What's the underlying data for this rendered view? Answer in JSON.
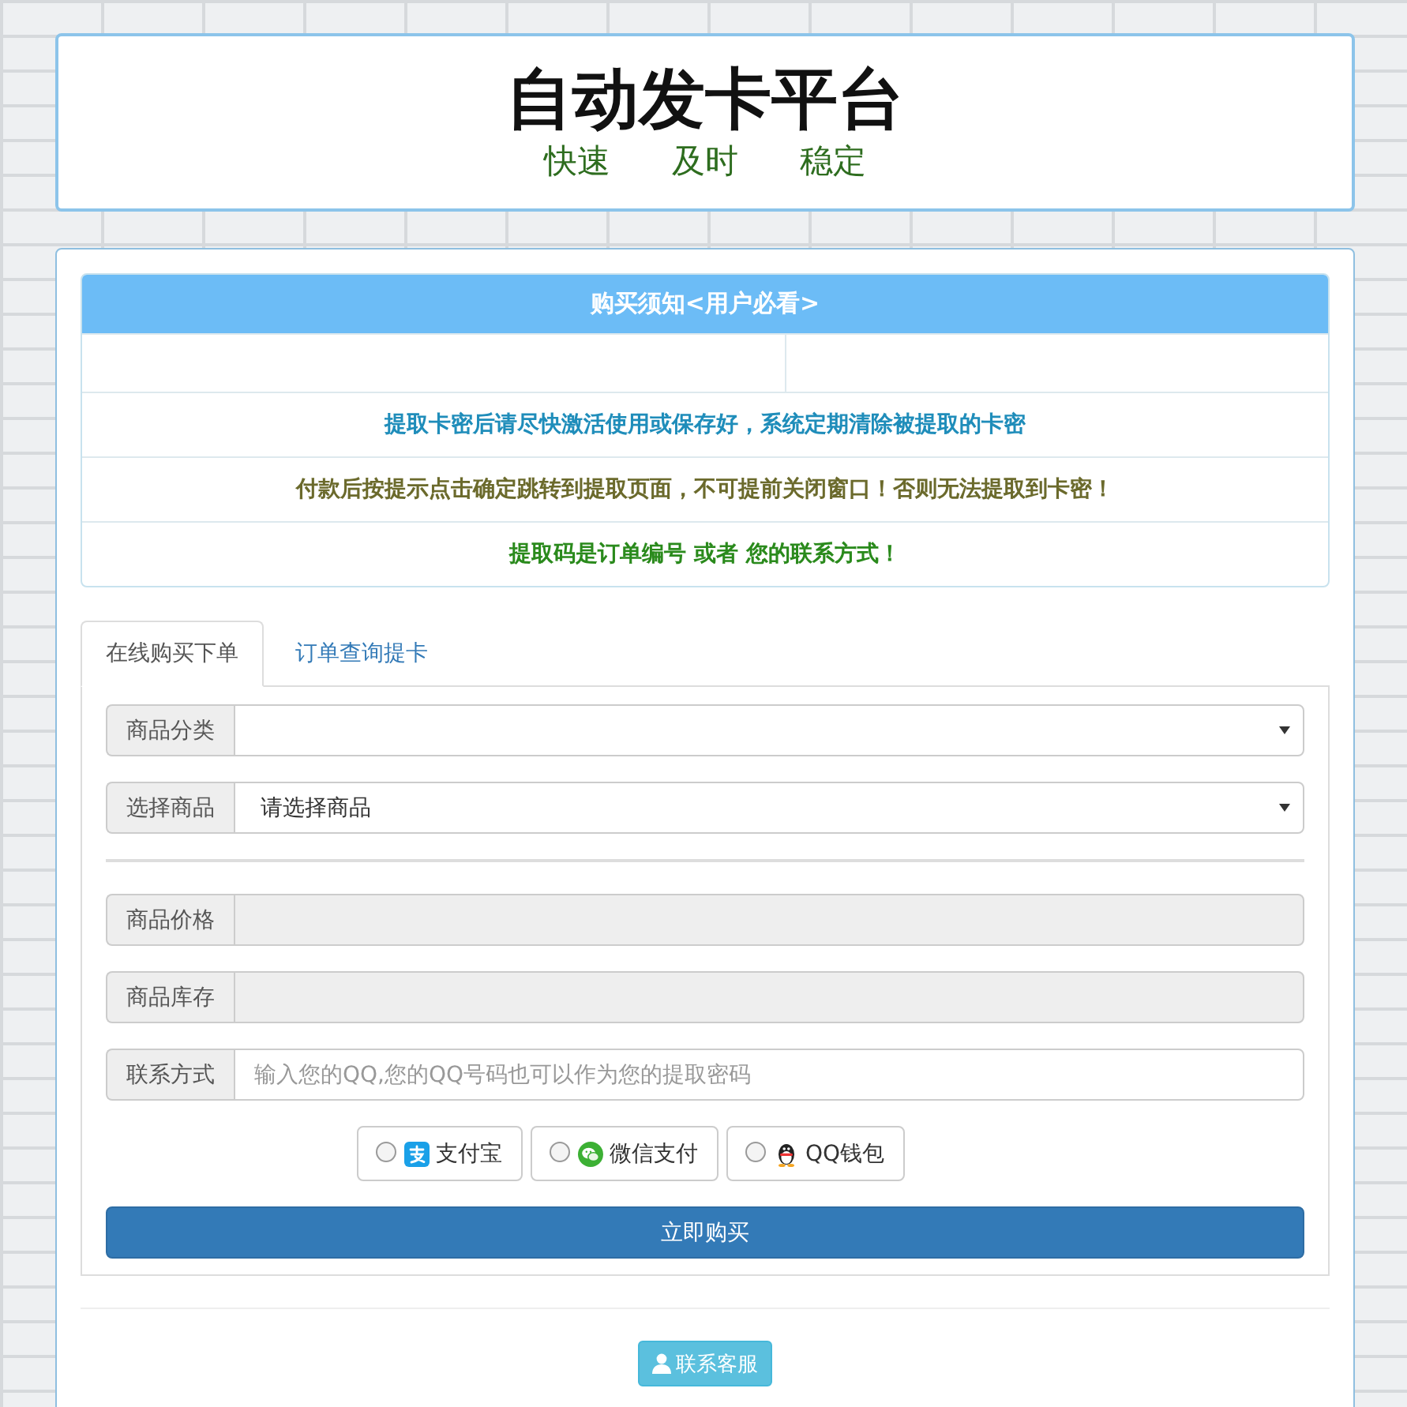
{
  "header": {
    "title": "自动发卡平台",
    "slogans": [
      "快速",
      "及时",
      "稳定"
    ]
  },
  "notice": {
    "title": "购买须知<用户必看>",
    "rows": [
      {
        "text": "提取卡密后请尽快激活使用或保存好，系统定期清除被提取的卡密",
        "color": "#1f8dba"
      },
      {
        "text": "付款后按提示点击确定跳转到提取页面，不可提前关闭窗口！否则无法提取到卡密！",
        "color": "#6b6a2c"
      },
      {
        "text": "提取码是订单编号 或者 您的联系方式！",
        "color": "#2a8a1c"
      }
    ]
  },
  "tabs": [
    {
      "label": "在线购买下单",
      "selected": true
    },
    {
      "label": "订单查询提卡",
      "selected": false
    }
  ],
  "form": {
    "selects": [
      {
        "label": "商品分类"
      },
      {
        "label": "选择商品",
        "value": "请选择商品"
      }
    ],
    "inputs": [
      {
        "label": "商品价格",
        "disabled": true
      },
      {
        "label": "商品库存",
        "disabled": true
      },
      {
        "label": "联系方式",
        "disabled": false,
        "placeholder": "输入您的QQ,您的QQ号码也可以作为您的提取密码"
      }
    ],
    "payments": [
      {
        "kind": "tile",
        "label": "支付宝",
        "selected": false
      },
      {
        "kind": "bubbles",
        "label": "微信支付",
        "selected": false
      },
      {
        "kind": "penguin",
        "label": "QQ钱包",
        "selected": false
      }
    ],
    "submit_button": "立即购买"
  },
  "contact_button": "联系客服"
}
